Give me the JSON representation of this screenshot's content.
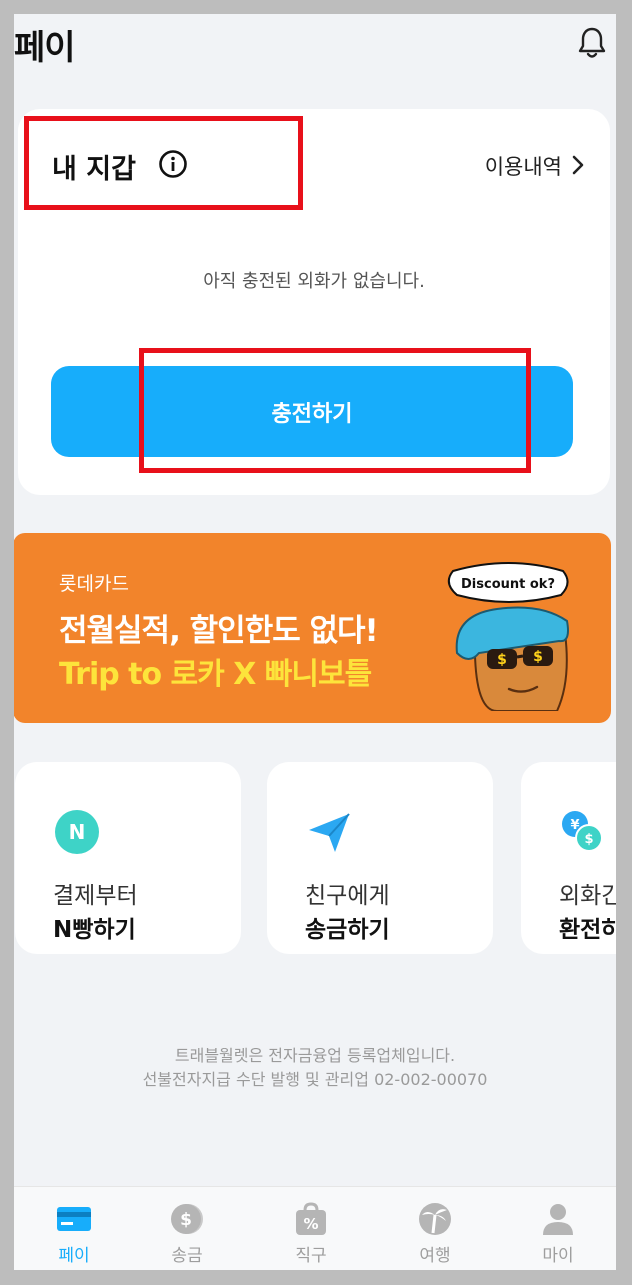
{
  "header": {
    "title": "페이",
    "bell_icon": "bell-icon"
  },
  "wallet": {
    "title": "내 지갑",
    "info_icon": "info-icon",
    "history_label": "이용내역",
    "empty_message": "아직 충전된 외화가 없습니다.",
    "charge_label": "충전하기",
    "accent_color": "#17adfb"
  },
  "banner": {
    "brand": "롯데카드",
    "headline": "전월실적, 할인한도 없다!",
    "subline": "Trip to 로카 X 빠니보틀",
    "sticker_text": "Discount ok?",
    "background_color": "#f2842b"
  },
  "services": [
    {
      "line1": "결제부터",
      "line2": "N빵하기",
      "icon": "n-badge-icon"
    },
    {
      "line1": "친구에게",
      "line2": "송금하기",
      "icon": "paper-plane-icon"
    },
    {
      "line1": "외화간",
      "line2": "환전하",
      "icon": "currency-exchange-icon"
    }
  ],
  "footer": {
    "line1": "트래블월렛은 전자금융업 등록업체입니다.",
    "line2": "선불전자지급 수단 발행 및 관리업 02-002-00070"
  },
  "tabs": [
    {
      "label": "페이",
      "icon": "card-icon",
      "active": true
    },
    {
      "label": "송금",
      "icon": "coin-icon",
      "active": false
    },
    {
      "label": "직구",
      "icon": "shopping-bag-icon",
      "active": false
    },
    {
      "label": "여행",
      "icon": "palm-tree-icon",
      "active": false
    },
    {
      "label": "마이",
      "icon": "person-icon",
      "active": false
    }
  ]
}
